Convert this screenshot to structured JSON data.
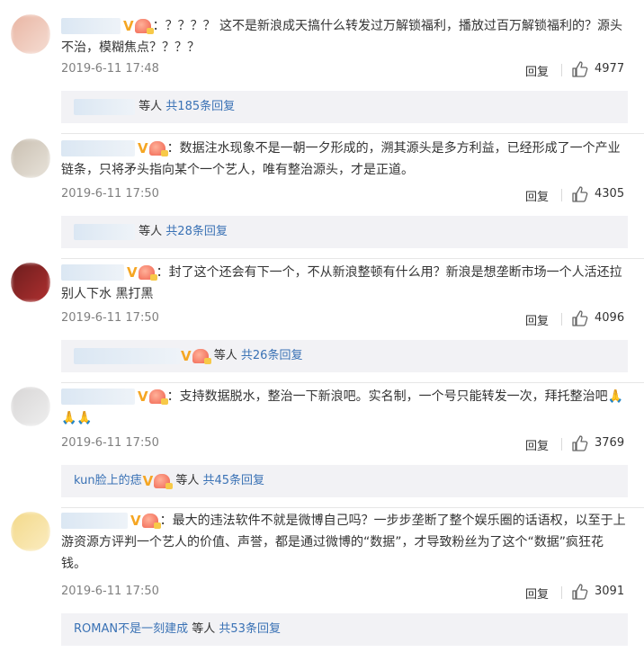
{
  "comments": [
    {
      "text": "：？？？？ 这不是新浪成天搞什么转发过万解锁福利，播放过百万解锁福利的？源头不治，模糊焦点？？？？",
      "time": "2019-6-11 17:48",
      "reply_label": "回复",
      "likes": "4977",
      "reply_summary": {
        "replier": "",
        "badges": false,
        "people": "等人",
        "count": "共185条回复"
      },
      "avatar_colors": [
        "#e9b5a3",
        "#f5ddd3"
      ]
    },
    {
      "text": "：数据注水现象不是一朝一夕形成的，溯其源头是多方利益，已经形成了一个产业链条，只将矛头指向某个一个艺人，唯有整治源头，才是正道。",
      "time": "2019-6-11 17:50",
      "reply_label": "回复",
      "likes": "4305",
      "reply_summary": {
        "replier": "",
        "badges": false,
        "people": "等人",
        "count": "共28条回复"
      },
      "avatar_colors": [
        "#c9bfb1",
        "#e8e3da"
      ]
    },
    {
      "text": "：封了这个还会有下一个，不从新浪整顿有什么用？新浪是想垄断市场一个人活还拉别人下水 黑打黑",
      "time": "2019-6-11 17:50",
      "reply_label": "回复",
      "likes": "4096",
      "reply_summary": {
        "replier": "",
        "badges": true,
        "people": "等人",
        "count": "共26条回复"
      },
      "avatar_colors": [
        "#6b1d1d",
        "#b03030"
      ]
    },
    {
      "text": "：支持数据脱水，整治一下新浪吧。实名制，一个号只能转发一次，拜托整治吧🙏🙏🙏",
      "time": "2019-6-11 17:50",
      "reply_label": "回复",
      "likes": "3769",
      "reply_summary": {
        "replier": "kun脸上的痣",
        "badges": true,
        "people": "等人",
        "count": "共45条回复"
      },
      "avatar_colors": [
        "#d8d6d6",
        "#eeeeee"
      ]
    },
    {
      "text": "：最大的违法软件不就是微博自己吗？一步步垄断了整个娱乐圈的话语权，以至于上游资源方评判一个艺人的价值、声誉，都是通过微博的“数据”，才导致粉丝为了这个“数据”疯狂花钱。",
      "time": "2019-6-11 17:50",
      "reply_label": "回复",
      "likes": "3091",
      "reply_summary": {
        "replier": "ROMAN不是一刻建成",
        "badges": false,
        "people": "等人",
        "count": "共53条回复"
      },
      "avatar_colors": [
        "#f3d98a",
        "#fbecc0"
      ]
    }
  ],
  "colors": {
    "link": "#3a72b5",
    "meta": "#808080",
    "reply_bg": "#f2f2f5",
    "divider": "#e6e6e6",
    "badge_v": "#f5a623"
  },
  "icons": {
    "like": "thumbs-up-icon",
    "verified": "v-badge-icon",
    "fan": "fan-badge-icon"
  }
}
